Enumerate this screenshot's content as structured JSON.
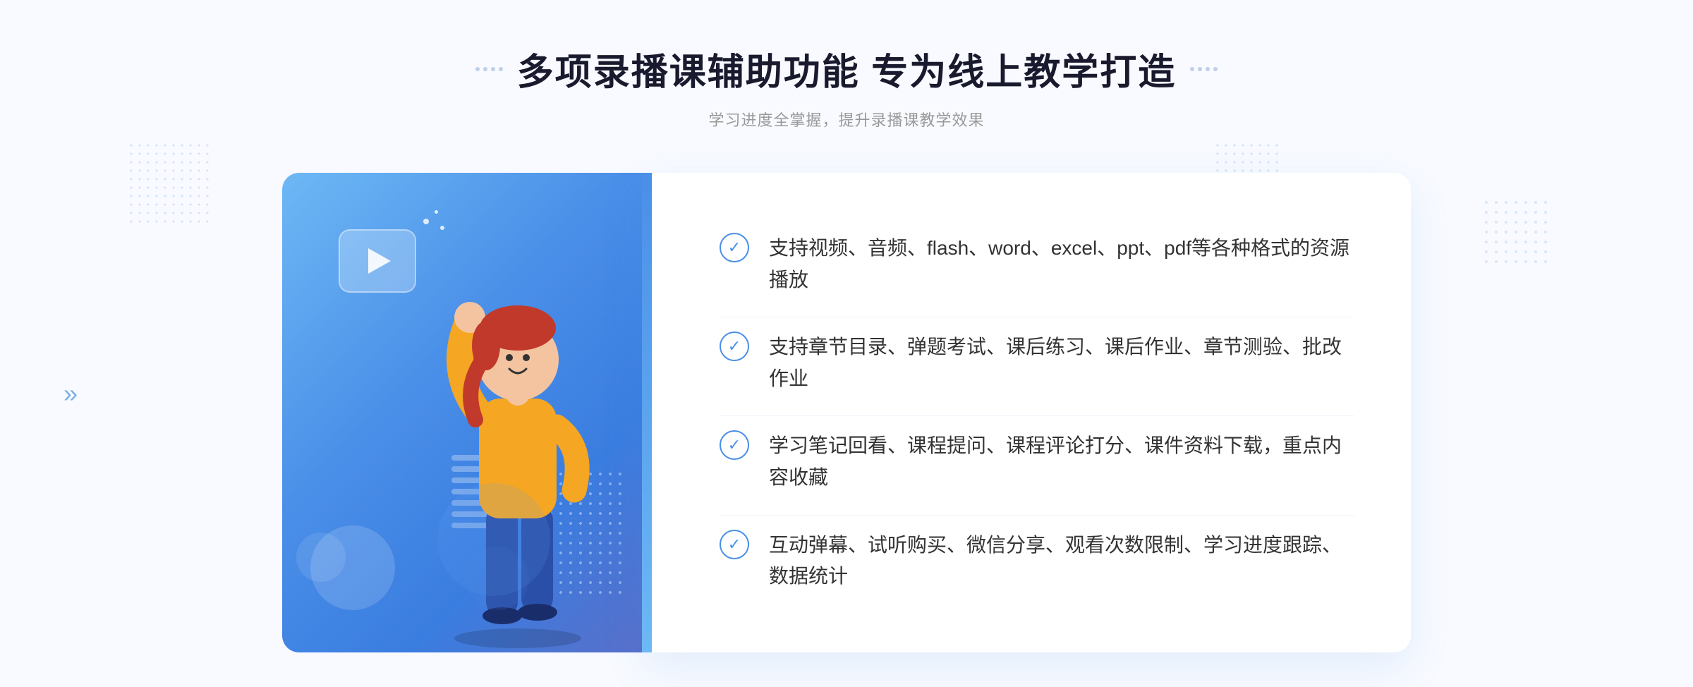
{
  "page": {
    "background_color": "#f8faff"
  },
  "header": {
    "title": "多项录播课辅助功能 专为线上教学打造",
    "subtitle": "学习进度全掌握，提升录播课教学效果",
    "title_dots_count": 2
  },
  "features": [
    {
      "id": 1,
      "text": "支持视频、音频、flash、word、excel、ppt、pdf等各种格式的资源播放"
    },
    {
      "id": 2,
      "text": "支持章节目录、弹题考试、课后练习、课后作业、章节测验、批改作业"
    },
    {
      "id": 3,
      "text": "学习笔记回看、课程提问、课程评论打分、课件资料下载，重点内容收藏"
    },
    {
      "id": 4,
      "text": "互动弹幕、试听购买、微信分享、观看次数限制、学习进度跟踪、数据统计"
    }
  ],
  "icons": {
    "play": "▶",
    "check": "✓",
    "chevron": "»"
  }
}
